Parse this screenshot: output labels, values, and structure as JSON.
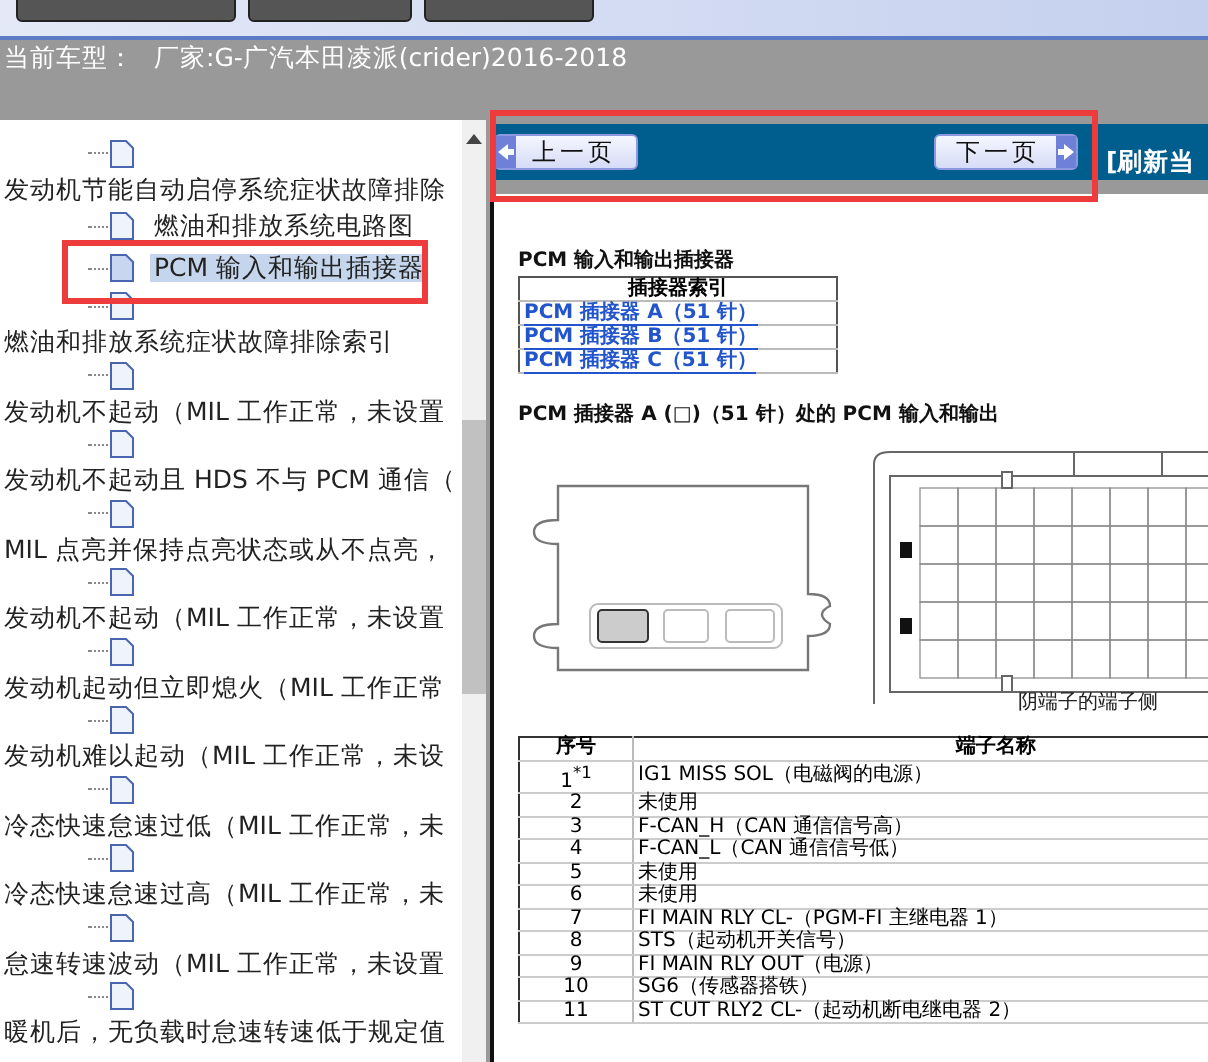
{
  "vehicle_bar": {
    "label": "当前车型：",
    "value": "厂家:G-广汽本田凌派(crider)2016-2018"
  },
  "tree": {
    "items": [
      {
        "kind": "page",
        "selected": false
      },
      {
        "kind": "topic",
        "label": "发动机节能自动启停系统症状故障排除",
        "children": [
          {
            "label": "燃油和排放系统电路图",
            "selected": false
          },
          {
            "label": "PCM 输入和输出插接器",
            "selected": true
          },
          {
            "selected": false
          }
        ]
      },
      {
        "kind": "topic",
        "label": "燃油和排放系统症状故障排除索引",
        "children": [
          {
            "selected": false
          }
        ]
      },
      {
        "kind": "topic",
        "label": "发动机不起动（MIL 工作正常，未设置",
        "children": [
          {
            "selected": false
          }
        ]
      },
      {
        "kind": "topic",
        "label": "发动机不起动且 HDS 不与 PCM 通信（",
        "children": [
          {
            "selected": false
          }
        ]
      },
      {
        "kind": "topic",
        "label": "MIL 点亮并保持点亮状态或从不点亮，",
        "children": [
          {
            "selected": false
          }
        ]
      },
      {
        "kind": "topic",
        "label": "发动机不起动（MIL 工作正常，未设置",
        "children": [
          {
            "selected": false
          }
        ]
      },
      {
        "kind": "topic",
        "label": "发动机起动但立即熄火（MIL 工作正常",
        "children": [
          {
            "selected": false
          }
        ]
      },
      {
        "kind": "topic",
        "label": "发动机难以起动（MIL 工作正常，未设",
        "children": [
          {
            "selected": false
          }
        ]
      },
      {
        "kind": "topic",
        "label": "冷态快速怠速过低（MIL 工作正常，未",
        "children": [
          {
            "selected": false
          }
        ]
      },
      {
        "kind": "topic",
        "label": "冷态快速怠速过高（MIL 工作正常，未",
        "children": [
          {
            "selected": false
          }
        ]
      },
      {
        "kind": "topic",
        "label": "怠速转速波动（MIL 工作正常，未设置",
        "children": [
          {
            "selected": false
          }
        ]
      },
      {
        "kind": "topic",
        "label": "暖机后，无负载时怠速转速低于规定值"
      }
    ]
  },
  "viewer": {
    "nav": {
      "prev": "上一页",
      "next": "下一页",
      "refresh": "[刷新当"
    },
    "document": {
      "title": "PCM 输入和输出插接器",
      "index_table": {
        "header": "插接器索引",
        "links": [
          "PCM 插接器 A（51 针）",
          "PCM 插接器 B（51 针）",
          "PCM 插接器 C（51 针）"
        ]
      },
      "section_title": "PCM 插接器 A (□)（51 针）处的 PCM 输入和输出",
      "caption": "阴端子的端子侧",
      "pin_table": {
        "columns": [
          "序号",
          "端子名称"
        ],
        "rows": [
          [
            "1$^{*1}$",
            "IG1 MISS SOL（电磁阀的电源）"
          ],
          [
            "2",
            "未使用"
          ],
          [
            "3",
            "F-CAN_H（CAN 通信信号高）"
          ],
          [
            "4",
            "F-CAN_L（CAN 通信信号低）"
          ],
          [
            "5",
            "未使用"
          ],
          [
            "6",
            "未使用"
          ],
          [
            "7",
            "FI MAIN RLY CL-（PGM-FI 主继电器 1）"
          ],
          [
            "8",
            "STS（起动机开关信号）"
          ],
          [
            "9",
            "FI MAIN RLY OUT（电源）"
          ],
          [
            "10",
            "SG6（传感器搭铁）"
          ],
          [
            "11",
            "ST CUT RLY2 CL-（起动机断电继电器 2）"
          ]
        ]
      }
    }
  }
}
